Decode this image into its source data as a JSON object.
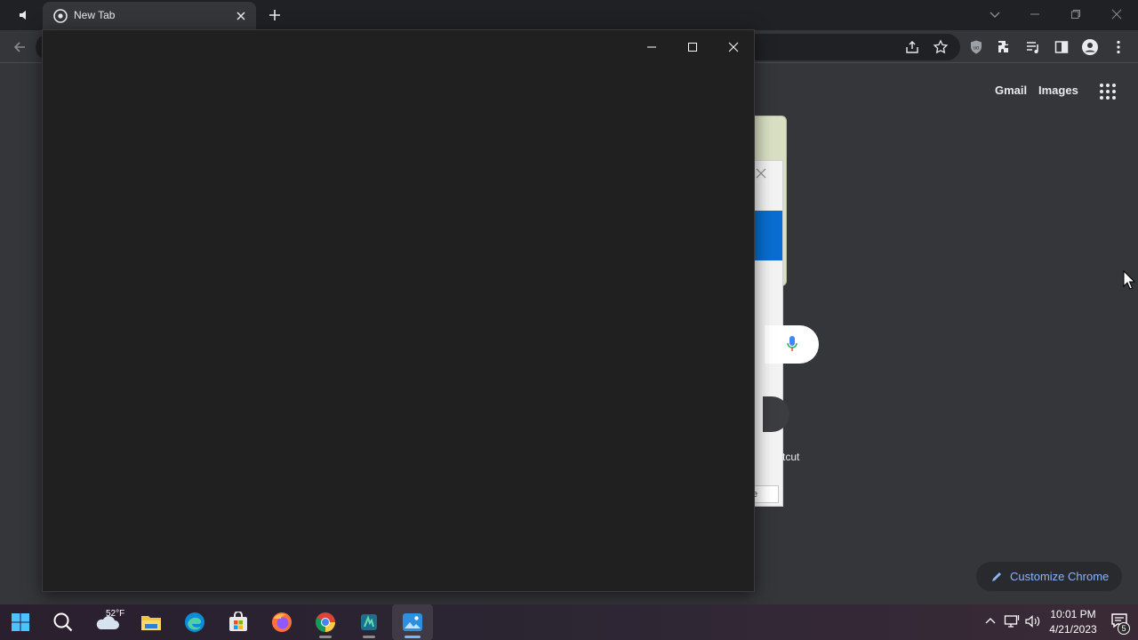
{
  "browser": {
    "tab": {
      "title": "New Tab",
      "icons": {
        "audio": "speaker-icon",
        "favicon": "chrome-icon",
        "close": "close-icon"
      }
    },
    "new_tab_icon": "plus-icon",
    "tab_search_icon": "chevron-down-icon",
    "window_controls": [
      "minimize-icon",
      "restore-icon",
      "close-icon"
    ],
    "toolbar_icons": [
      "share-icon",
      "star-icon",
      "ublock-icon",
      "extensions-icon",
      "media-icon",
      "side-panel-icon",
      "profile-icon",
      "menu-icon"
    ]
  },
  "ntp": {
    "gmail": "Gmail",
    "images": "Images",
    "customize": "Customize Chrome",
    "partial_shortcut_text": "tcut",
    "partial_field_text": "e"
  },
  "front_window": {
    "controls": [
      "minimize-icon",
      "maximize-icon",
      "close-icon"
    ]
  },
  "taskbar": {
    "apps": [
      "windows-start",
      "search",
      "weather",
      "file-explorer",
      "edge",
      "store",
      "firefox",
      "chrome",
      "app",
      "photos"
    ],
    "weather_temp": "52°F",
    "time": "10:01 PM",
    "date": "4/21/2023",
    "notification_count": "5"
  },
  "colors": {
    "accent": "#8ab4f8",
    "window_bg": "#202020",
    "page_bg": "#35363a",
    "taskbar_active": "#76b9ed"
  }
}
